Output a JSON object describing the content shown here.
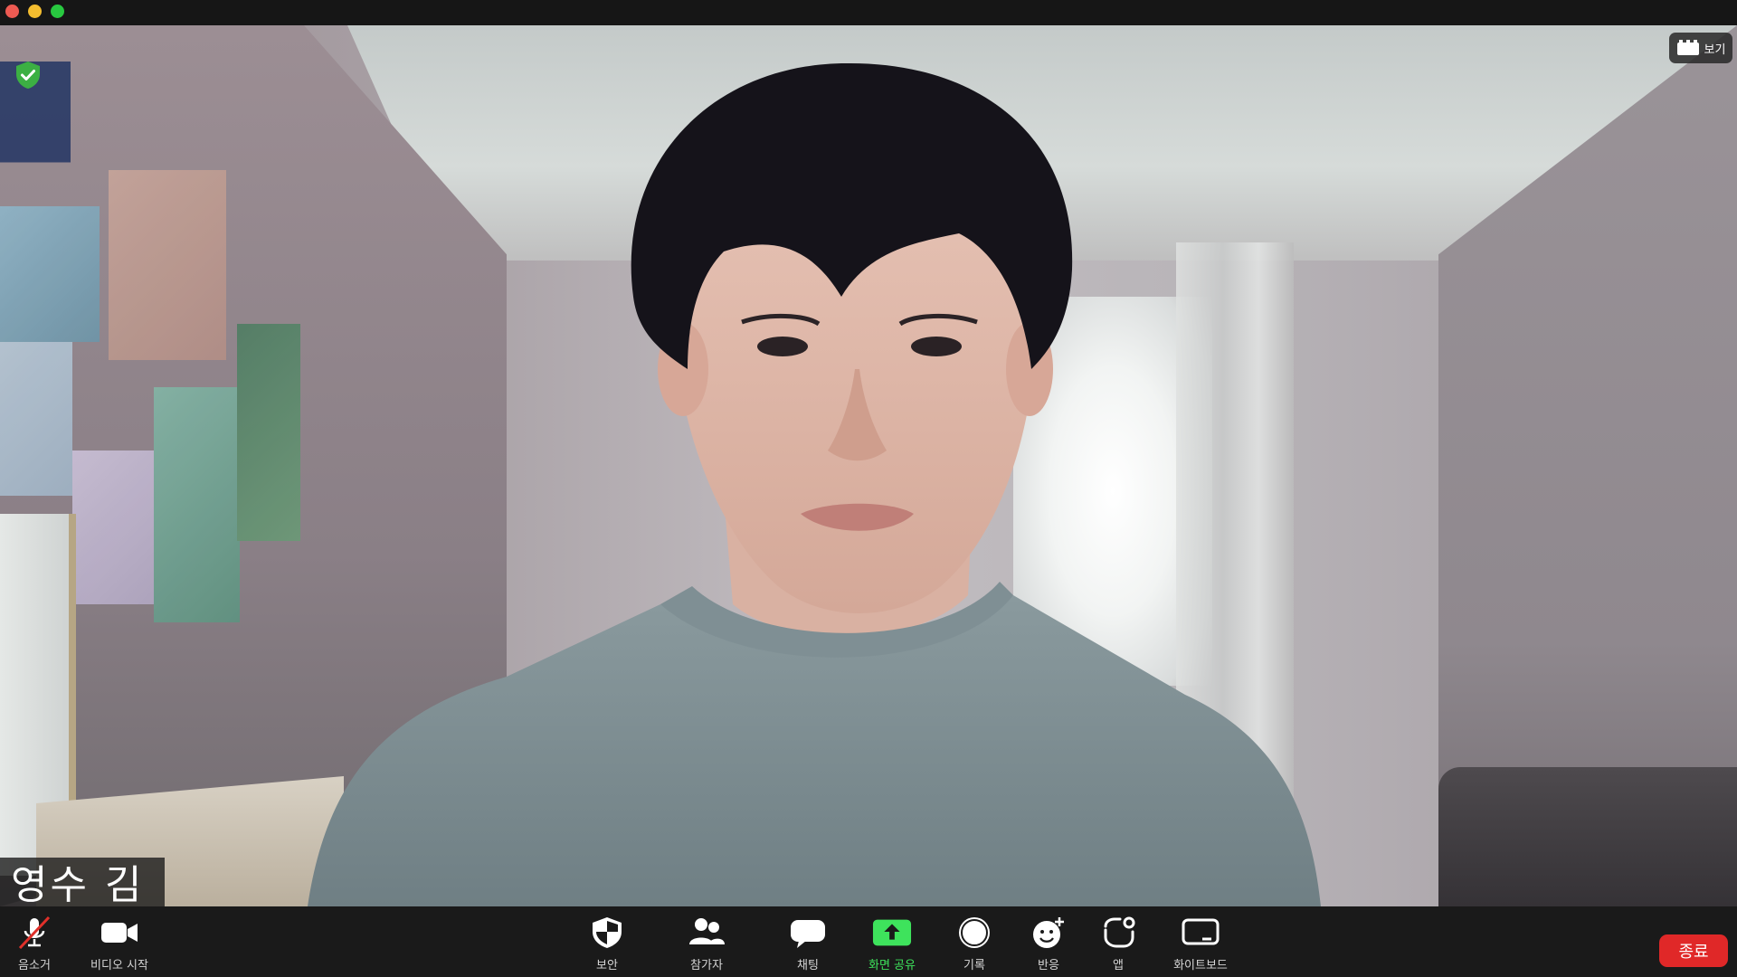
{
  "participant": {
    "name": "영수 김"
  },
  "top_bar": {
    "view_label": "보기"
  },
  "toolbar": {
    "mute_label": "음소거",
    "video_label": "비디오 시작",
    "security_label": "보안",
    "participants_label": "참가자",
    "chat_label": "채팅",
    "share_label": "화면 공유",
    "record_label": "기록",
    "reactions_label": "반응",
    "apps_label": "앱",
    "whiteboard_label": "화이트보드",
    "end_label": "종료"
  },
  "colors": {
    "share_accent": "#3ee35c",
    "end_button": "#e02828",
    "secure_shield": "#3cb043",
    "mute_slash": "#e0302a"
  },
  "icons": {
    "security_badge": "shield-check-icon",
    "view": "grid-icon",
    "mute": "microphone-muted-icon",
    "video": "video-camera-icon",
    "security": "shield-icon",
    "participants": "people-icon",
    "chat": "chat-bubble-icon",
    "share": "share-screen-up-arrow-icon",
    "record": "record-circle-icon",
    "reactions": "smiley-plus-icon",
    "apps": "apps-icon",
    "whiteboard": "whiteboard-icon"
  }
}
